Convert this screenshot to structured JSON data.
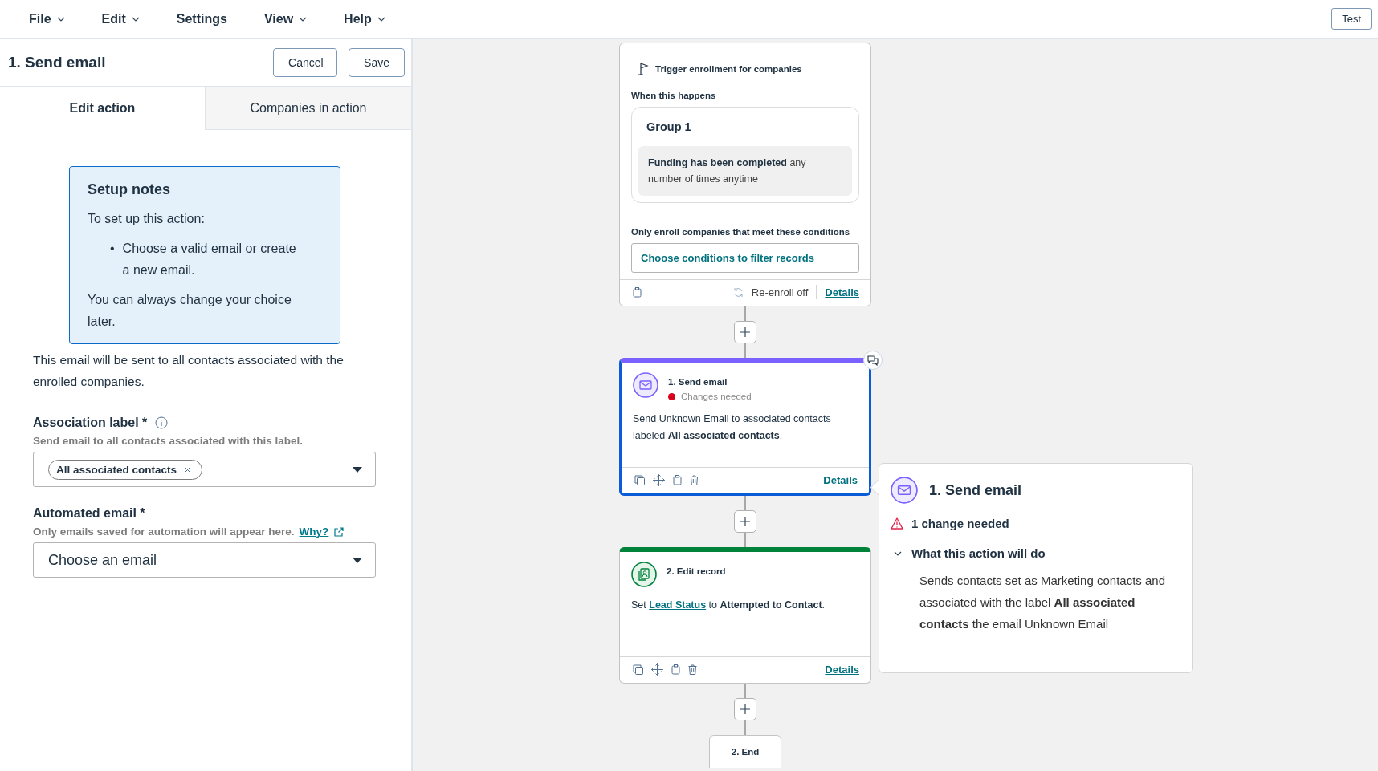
{
  "menu": [
    {
      "label": "File",
      "has_caret": true
    },
    {
      "label": "Edit",
      "has_caret": true
    },
    {
      "label": "Settings",
      "has_caret": false
    },
    {
      "label": "View",
      "has_caret": true
    },
    {
      "label": "Help",
      "has_caret": true
    }
  ],
  "test_button": "Test",
  "panel": {
    "title": "1. Send email",
    "buttons": [
      "Cancel",
      "Save"
    ],
    "tabs": [
      {
        "label": "Edit action",
        "selected": true
      },
      {
        "label": "Companies in action",
        "selected": false
      }
    ],
    "setup_notes": {
      "title": "Setup notes",
      "intro": "To set up this action:",
      "bullets": [
        {
          "marker": "•",
          "text": "Choose a valid email or create a new email."
        }
      ],
      "outro": "You can always change your choice later."
    },
    "description": "This email will be sent to all contacts associated with the enrolled companies.",
    "fields": [
      {
        "kind": "tags",
        "label": "Association label *",
        "info": true,
        "hint": "Send email to all contacts associated with this label.",
        "tags": [
          "All associated contacts"
        ]
      },
      {
        "kind": "select",
        "label": "Automated email *",
        "info": false,
        "hint": "Only emails saved for automation will appear here.",
        "link": "Why?",
        "placeholder": "Choose an email"
      }
    ]
  },
  "canvas": {
    "trigger": {
      "title": "Trigger enrollment for companies",
      "when_label": "When this happens",
      "group_title": "Group 1",
      "condition": "**Funding has been completed** any number of times anytime",
      "filter_label": "Only enroll companies that meet these conditions",
      "filter_button": "Choose conditions to filter records",
      "reenroll": "Re-enroll off",
      "details": "Details"
    },
    "actions": [
      {
        "kind": "email",
        "title": "1. Send email",
        "status": "Changes needed",
        "selected": true,
        "text": "Send Unknown Email to associated contacts labeled **All associated contacts**.",
        "details": "Details"
      },
      {
        "kind": "edit",
        "title": "2. Edit record",
        "selected": false,
        "text_before": "Set",
        "link": "Lead Status",
        "text": "to **Attempted to Contact**.",
        "details": "Details"
      }
    ],
    "end": "2. End"
  },
  "popover": {
    "title": "1. Send email",
    "alert": "1 change needed",
    "section_title": "What this action will do",
    "expanded": true,
    "text": "Sends contacts set as Marketing contacts and associated with the label **All associated contacts** the email Unknown Email"
  }
}
